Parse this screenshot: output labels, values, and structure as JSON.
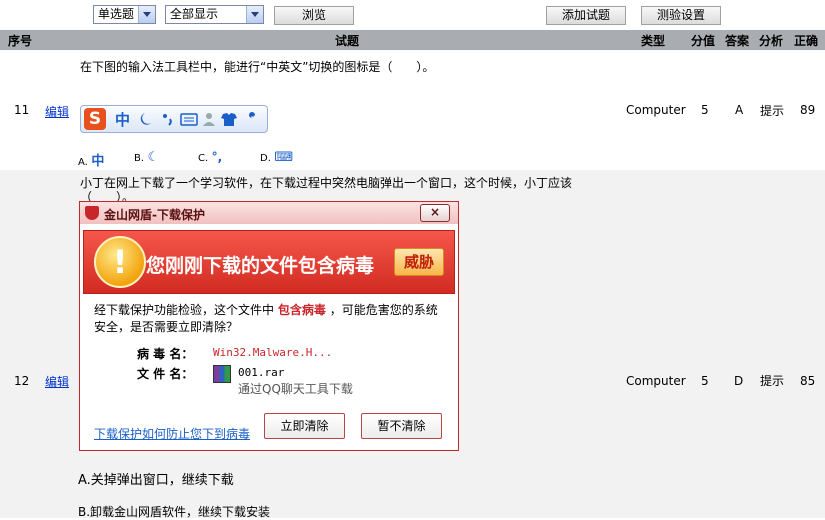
{
  "toolbar": {
    "type_select": "单选题",
    "display_select": "全部显示",
    "browse_btn": "浏览",
    "add_btn": "添加试题",
    "settings_btn": "测验设置"
  },
  "columns": [
    "序号",
    "试题",
    "类型",
    "分值",
    "答案",
    "分析",
    "正确"
  ],
  "rows": [
    {
      "num": "11",
      "edit": "编辑",
      "question": "在下图的输入法工具栏中，能进行“中英文”切换的图标是（　　）。",
      "ime_logo": "S",
      "ime_zh": "中",
      "options": [
        {
          "label": "A.",
          "value": "中"
        },
        {
          "label": "B.",
          "value": "☾"
        },
        {
          "label": "C.",
          "value": "°,"
        },
        {
          "label": "D.",
          "value": "⌨"
        }
      ],
      "type": "Computer",
      "score": "5",
      "answer": "A",
      "analysis": "提示",
      "correct": "89"
    },
    {
      "num": "12",
      "edit": "编辑",
      "question_line1": "小丁在网上下载了一个学习软件，在下载过程中突然电脑弹出一个窗口，这个时候，小丁应该",
      "question_line2": "（　　）。",
      "dialog": {
        "title": "金山网盾-下载保护",
        "close": "×",
        "banner": "您刚刚下载的文件包含病毒",
        "badge": "威胁",
        "body_pre": "经下载保护功能检验，这个文件中",
        "body_red": "包含病毒",
        "body_post": "，可能危害您的系统安全，是否需要立即清除？",
        "virus_label": "病 毒 名：",
        "virus_value": "Win32.Malware.H...",
        "file_label": "文 件 名：",
        "file_value": "001.rar",
        "file_source": "通过QQ聊天工具下载",
        "link": "下载保护如何防止您下到病毒",
        "btn_clear": "立即清除",
        "btn_keep": "暂不清除"
      },
      "option_a": "A.关掉弹出窗口，继续下载",
      "option_b": "B.卸载金山网盾软件，继续下载安装",
      "type": "Computer",
      "score": "5",
      "answer": "D",
      "analysis": "提示",
      "correct": "85"
    }
  ],
  "colors": {
    "header": "#a9adb1",
    "row_alt": "#f2f2f2",
    "dialog_red": "#d22b22",
    "link": "#0033cc"
  }
}
